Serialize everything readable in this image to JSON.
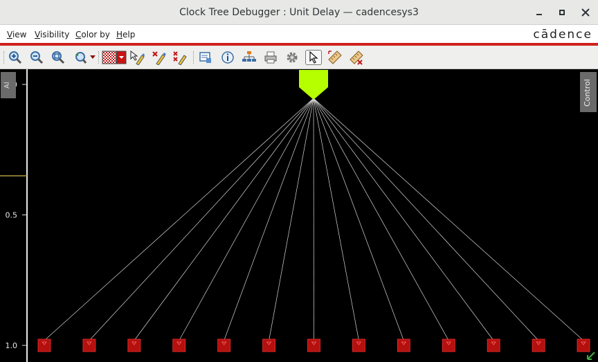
{
  "window": {
    "title": "Clock Tree Debugger : Unit Delay — cadencesys3",
    "min_label": "–",
    "max_label": "□",
    "close_label": "✕"
  },
  "menu": {
    "items": [
      {
        "label": "View",
        "underline": "V",
        "rest": "iew"
      },
      {
        "label": "Visibility",
        "underline": "V",
        "rest": "isibility"
      },
      {
        "label": "Color by",
        "underline": "C",
        "rest": "olor by"
      },
      {
        "label": "Help",
        "underline": "H",
        "rest": "elp"
      }
    ],
    "brand": "cādence"
  },
  "toolbar": {
    "buttons": [
      {
        "name": "zoom-in-icon"
      },
      {
        "name": "zoom-out-icon"
      },
      {
        "name": "zoom-fit-icon"
      },
      {
        "name": "undo-zoom-icon"
      },
      {
        "name": "color-pattern-icon"
      },
      {
        "name": "highlight-select-icon"
      },
      {
        "name": "highlight-clear-icon"
      },
      {
        "name": "highlight-clear-all-icon"
      },
      {
        "name": "report-icon"
      },
      {
        "name": "info-icon"
      },
      {
        "name": "hierarchy-icon"
      },
      {
        "name": "print-icon"
      },
      {
        "name": "settings-icon"
      },
      {
        "name": "select-pointer-icon"
      },
      {
        "name": "ruler-icon"
      },
      {
        "name": "ruler-clear-icon"
      }
    ],
    "active": "select-pointer-icon"
  },
  "canvas": {
    "left_tab_label": "Al",
    "right_tab_label": "Control",
    "axis_ticks": [
      "0.0",
      "0.5",
      "1.0"
    ],
    "axis_values": [
      0.0,
      0.5,
      1.0
    ],
    "marker_value": 0.35,
    "root_color": "#b6ff00",
    "sink_color": "#b3100e",
    "sink_count": 13
  }
}
